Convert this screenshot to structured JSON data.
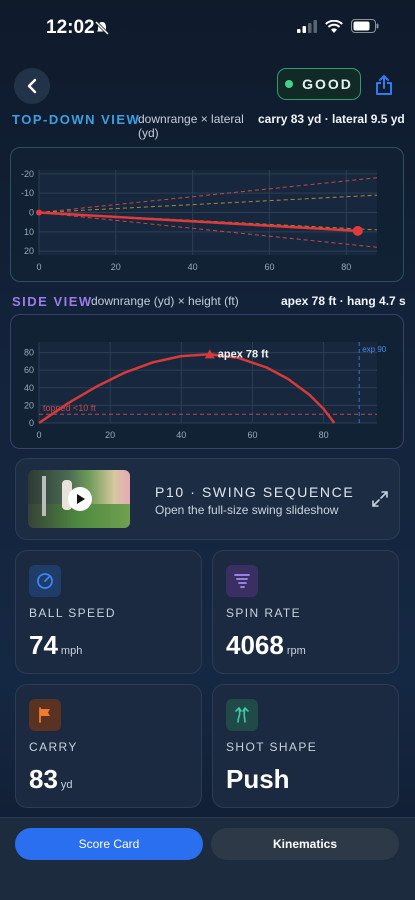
{
  "status_bar": {
    "time": "12:02"
  },
  "header": {
    "badge": "GOOD",
    "badge_color": "#43d28a",
    "accent": "#2f7bf2"
  },
  "top_down": {
    "title": "TOP-DOWN VIEW",
    "subtitle_line1": "downrange × lateral",
    "subtitle_line2": "(yd)",
    "stats": "carry 83 yd · lateral 9.5 yd",
    "title_color": "#3aa0e0"
  },
  "side_view": {
    "title": "SIDE VIEW",
    "subtitle": "downrange (yd) × height (ft)",
    "stats": "apex 78 ft · hang 4.7 s",
    "title_color": "#9b7ce8"
  },
  "sequence": {
    "title": "P10 · SWING SEQUENCE",
    "subtitle": "Open the full-size swing slideshow"
  },
  "metrics": [
    {
      "label": "BALL SPEED",
      "value": "74",
      "unit": "mph",
      "icon": "gauge-icon",
      "icon_bg": "#1f3d68"
    },
    {
      "label": "SPIN RATE",
      "value": "4068",
      "unit": "rpm",
      "icon": "tornado-icon",
      "icon_bg": "#3a2f63"
    },
    {
      "label": "CARRY",
      "value": "83",
      "unit": "yd",
      "icon": "flag-icon",
      "icon_bg": "#5a3222"
    },
    {
      "label": "SHOT SHAPE",
      "value": "Push",
      "unit": "",
      "icon": "curve-arrows-icon",
      "icon_bg": "#1f4a48"
    }
  ],
  "tabs": {
    "scorecard": "Score Card",
    "kinematics": "Kinematics"
  },
  "chart_data": [
    {
      "type": "line",
      "title": "TOP-DOWN VIEW",
      "xlabel": "downrange",
      "ylabel": "lateral (yd)",
      "x_ticks": [
        0,
        20,
        40,
        60,
        80
      ],
      "y_ticks": [
        -20,
        -10,
        0,
        10,
        20
      ],
      "xlim": [
        0,
        88
      ],
      "ylim": [
        -22,
        22
      ],
      "y_inverted": true,
      "grid": true,
      "series": [
        {
          "x": [
            0,
            83
          ],
          "y": [
            0,
            9.5
          ],
          "color": "#e03a3a"
        }
      ],
      "guides": [
        {
          "x": [
            0,
            88
          ],
          "y": [
            0,
            -18
          ],
          "color": "#c24a4a"
        },
        {
          "x": [
            0,
            88
          ],
          "y": [
            0,
            -9
          ],
          "color": "#a88a3a"
        },
        {
          "x": [
            0,
            88
          ],
          "y": [
            0,
            9
          ],
          "color": "#a88a3a"
        },
        {
          "x": [
            0,
            88
          ],
          "y": [
            0,
            18
          ],
          "color": "#c24a4a"
        }
      ],
      "end_marker": {
        "x": 83,
        "y": 9.5
      }
    },
    {
      "type": "line",
      "title": "SIDE VIEW",
      "xlabel": "downrange (yd)",
      "ylabel": "height (ft)",
      "x_ticks": [
        0,
        20,
        40,
        60,
        80
      ],
      "y_ticks": [
        0,
        20,
        40,
        60,
        80
      ],
      "xlim": [
        0,
        95
      ],
      "ylim": [
        0,
        92
      ],
      "grid": true,
      "series": [
        {
          "x": [
            0,
            8,
            16,
            24,
            32,
            40,
            48,
            56,
            64,
            70,
            76,
            80,
            83
          ],
          "y": [
            0,
            22,
            41,
            57,
            69,
            76,
            78,
            74,
            63,
            50,
            32,
            16,
            0
          ],
          "color": "#d63a3a"
        }
      ],
      "apex": {
        "x": 48,
        "y": 78,
        "label": "apex 78 ft"
      },
      "threshold": {
        "y": 10,
        "label": "topped <10 ft"
      },
      "expected": {
        "x": 90,
        "label": "exp 90"
      }
    }
  ]
}
